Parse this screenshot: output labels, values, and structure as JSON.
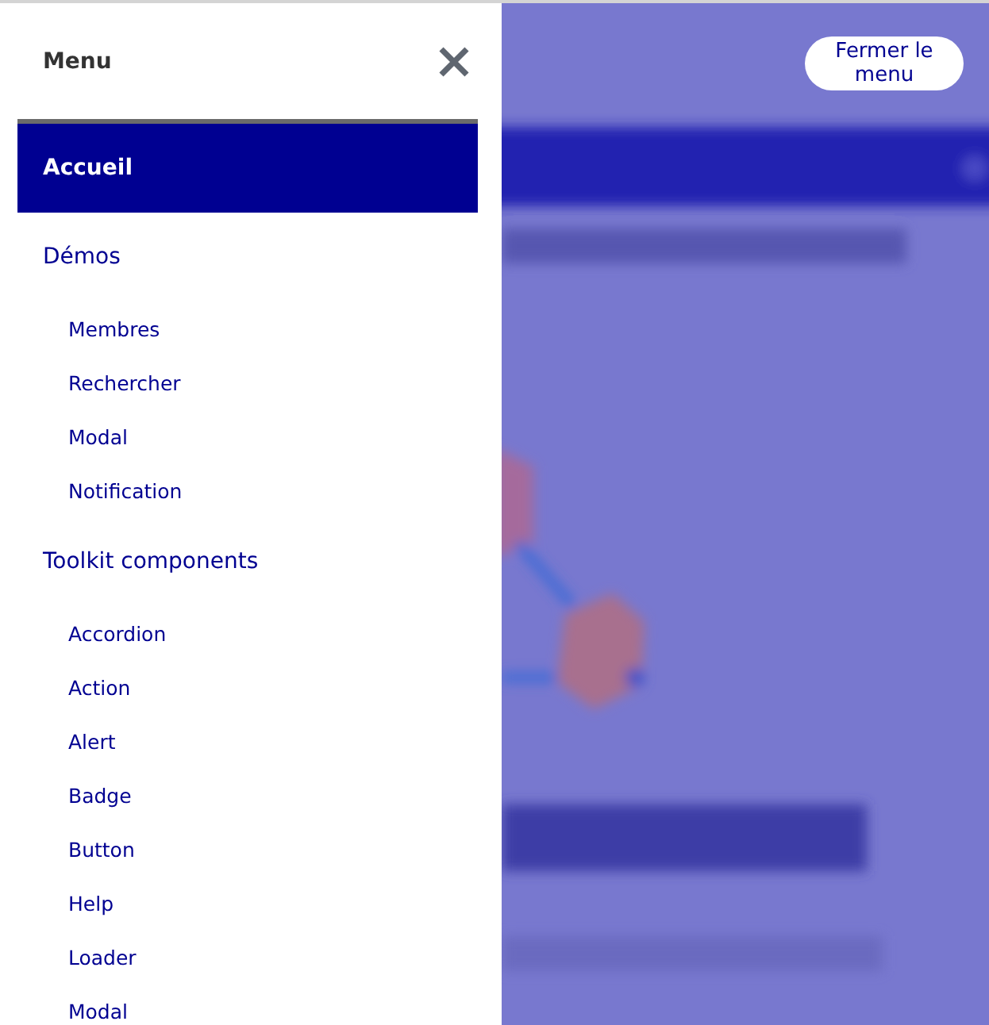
{
  "menu": {
    "title": "Menu",
    "items": [
      {
        "label": "Accueil",
        "selected": true
      },
      {
        "label": "Démos",
        "selected": false,
        "children": [
          {
            "label": "Membres",
            "selected": false
          },
          {
            "label": "Rechercher",
            "selected": false
          },
          {
            "label": "Modal",
            "selected": false
          },
          {
            "label": "Notification",
            "selected": false
          }
        ]
      },
      {
        "label": "Toolkit components",
        "selected": false,
        "children": [
          {
            "label": "Accordion",
            "selected": false
          },
          {
            "label": "Action",
            "selected": false
          },
          {
            "label": "Alert",
            "selected": false
          },
          {
            "label": "Badge",
            "selected": false
          },
          {
            "label": "Button",
            "selected": false
          },
          {
            "label": "Help",
            "selected": false
          },
          {
            "label": "Loader",
            "selected": false
          },
          {
            "label": "Modal",
            "selected": false
          }
        ]
      }
    ]
  },
  "close_menu_button": "Fermer le menu"
}
